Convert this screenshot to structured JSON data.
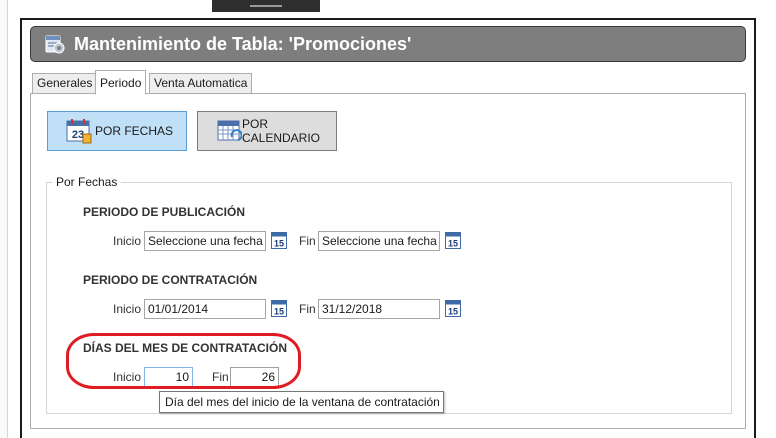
{
  "window": {
    "title": "Mantenimiento de Tabla: 'Promociones'"
  },
  "tabs": [
    {
      "label": "Generales",
      "active": false
    },
    {
      "label": "Periodo",
      "active": true
    },
    {
      "label": "Venta Automatica",
      "active": false
    }
  ],
  "mode_buttons": {
    "por_fechas": {
      "label": "POR FECHAS",
      "icon": "calendar-23-icon",
      "selected": true
    },
    "por_calendario": {
      "label": "POR CALENDARIO",
      "icon": "calendar-grid-icon",
      "selected": false
    }
  },
  "groupbox": {
    "label": "Por Fechas"
  },
  "publicacion": {
    "title": "PERIODO DE PUBLICACIÓN",
    "inicio_label": "Inicio",
    "inicio_value": "Seleccione una fecha",
    "fin_label": "Fin",
    "fin_value": "Seleccione una fecha",
    "calendar_icon_text": "15"
  },
  "contratacion": {
    "title": "PERIODO DE CONTRATACIÓN",
    "inicio_label": "Inicio",
    "inicio_value": "01/01/2014",
    "fin_label": "Fin",
    "fin_value": "31/12/2018",
    "calendar_icon_text": "15"
  },
  "dias_mes": {
    "title": "DÍAS DEL MES DE CONTRATACIÓN",
    "inicio_label": "Inicio",
    "inicio_value": "10",
    "fin_label": "Fin",
    "fin_value": "26"
  },
  "tooltip": {
    "text": "Día del mes del inicio de la ventana de contratación"
  },
  "colors": {
    "accent_selected": "#bfe0f6",
    "highlight_ring": "#e01b22",
    "titlebar": "#7e7e7e"
  }
}
